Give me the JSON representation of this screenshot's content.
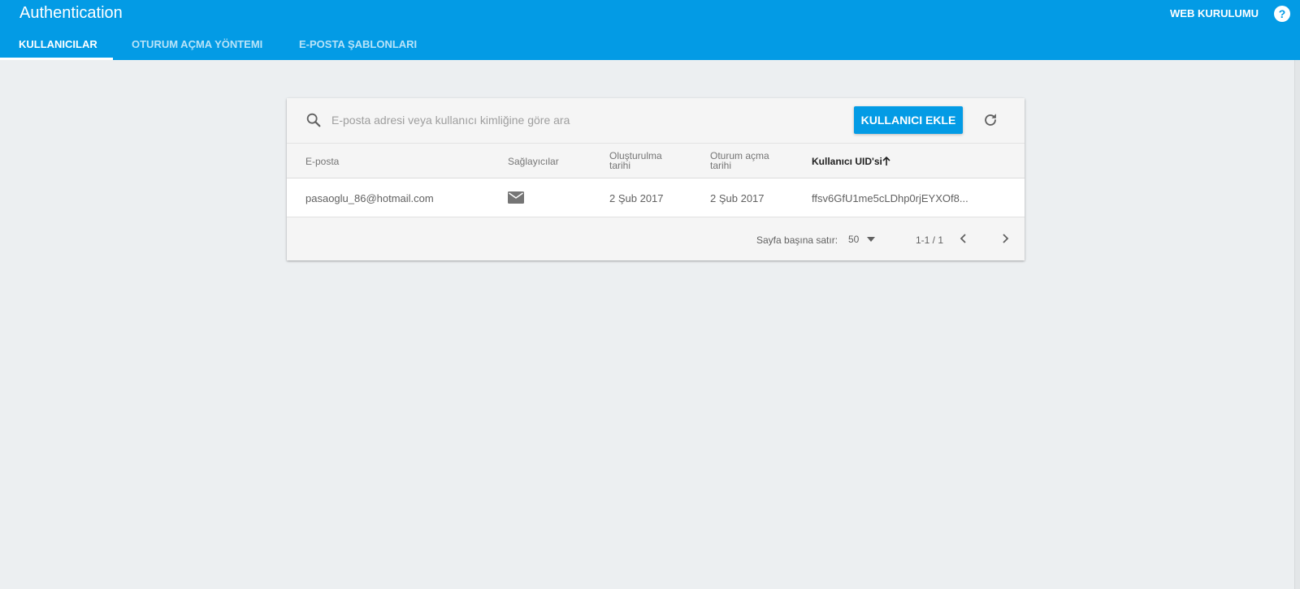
{
  "header": {
    "title": "Authentication",
    "web_setup_label": "WEB KURULUMU",
    "help_label": "?",
    "tabs": [
      {
        "label": "KULLANICILAR",
        "active": true
      },
      {
        "label": "OTURUM AÇMA YÖNTEMI",
        "active": false
      },
      {
        "label": "E-POSTA ŞABLONLARI",
        "active": false
      }
    ]
  },
  "search": {
    "placeholder": "E-posta adresi veya kullanıcı kimliğine göre ara",
    "value": "",
    "icon": "search-icon"
  },
  "toolbar": {
    "add_user_label": "KULLANICI EKLE",
    "refresh_icon": "refresh-icon"
  },
  "table": {
    "columns": [
      {
        "line1": "E-posta",
        "line2": ""
      },
      {
        "line1": "Sağlayıcılar",
        "line2": ""
      },
      {
        "line1": "Oluşturulma",
        "line2": "tarihi"
      },
      {
        "line1": "Oturum açma",
        "line2": "tarihi"
      },
      {
        "line1": "Kullanıcı UID'si",
        "line2": "",
        "sorted": "ascending"
      }
    ],
    "rows": [
      {
        "email": "pasaoglu_86@hotmail.com",
        "provider_icon": "mail-icon",
        "created": "2 Şub 2017",
        "signed_in": "2 Şub 2017",
        "uid": "ffsv6GfU1me5cLDhp0rjEYXOf8..."
      }
    ]
  },
  "pagination": {
    "rows_per_page_label": "Sayfa başına satır:",
    "rows_per_page_value": "50",
    "range": "1-1 / 1"
  },
  "colors": {
    "primary": "#039be5",
    "background": "#eceff1",
    "card_header": "#f5f5f5"
  }
}
